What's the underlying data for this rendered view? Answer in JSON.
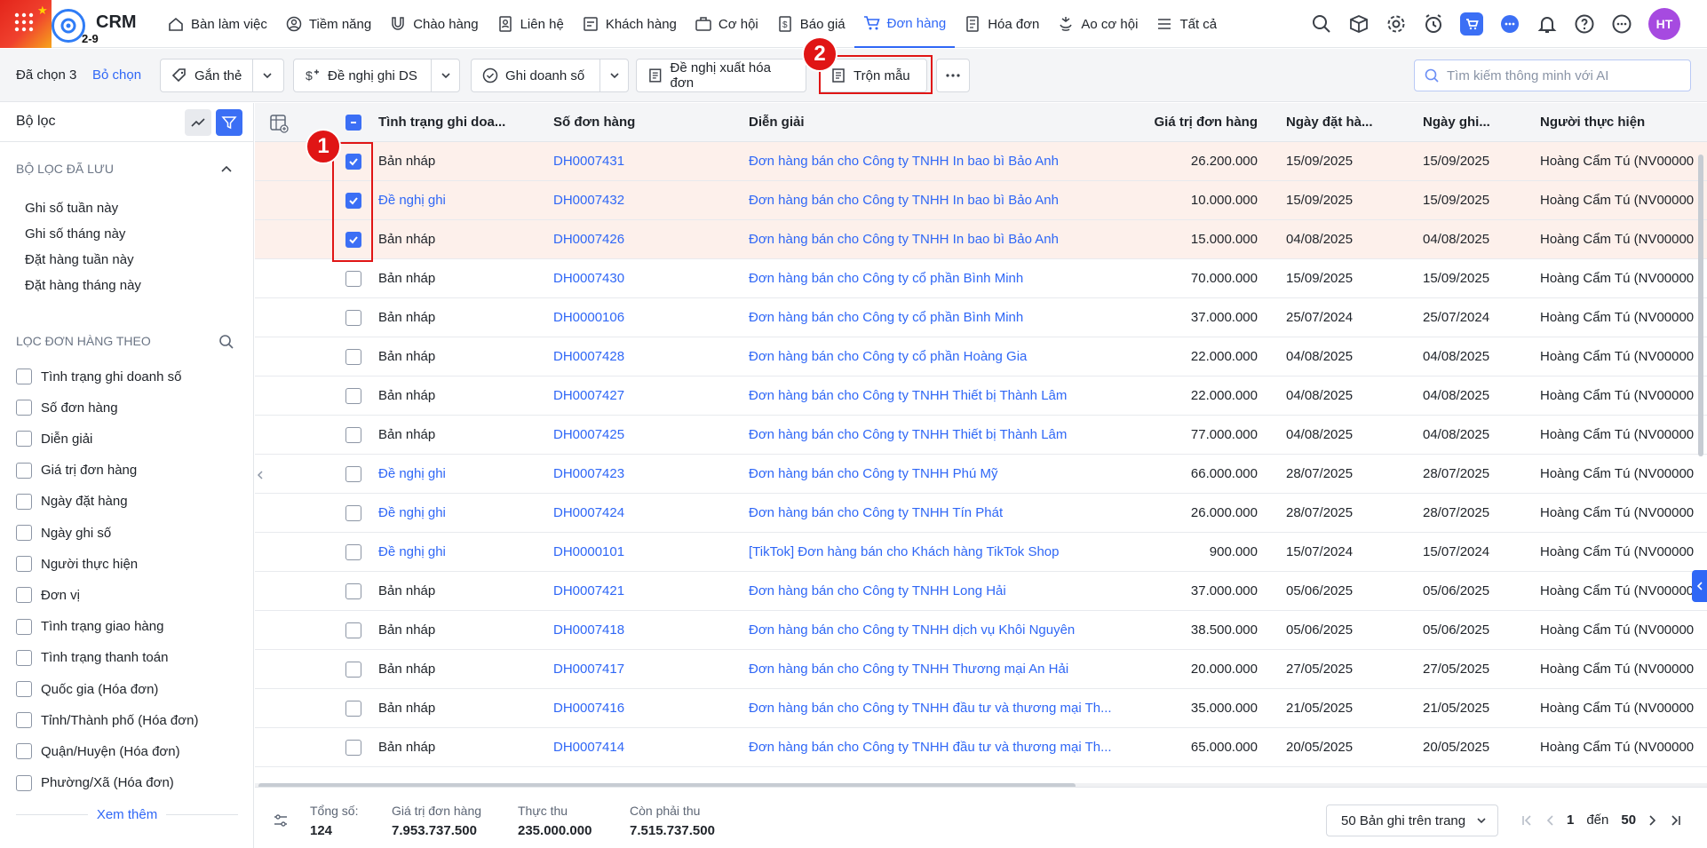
{
  "app": {
    "name": "CRM",
    "sub": "2-9"
  },
  "nav": [
    {
      "label": "Bàn làm việc",
      "icon": "home-icon",
      "active": false
    },
    {
      "label": "Tiềm năng",
      "icon": "prospect-icon",
      "active": false
    },
    {
      "label": "Chào hàng",
      "icon": "magnet-icon",
      "active": false
    },
    {
      "label": "Liên hệ",
      "icon": "contact-icon",
      "active": false
    },
    {
      "label": "Khách hàng",
      "icon": "customer-icon",
      "active": false
    },
    {
      "label": "Cơ hội",
      "icon": "briefcase-icon",
      "active": false
    },
    {
      "label": "Báo giá",
      "icon": "quote-icon",
      "active": false
    },
    {
      "label": "Đơn hàng",
      "icon": "cart-icon",
      "active": true
    },
    {
      "label": "Hóa đơn",
      "icon": "invoice-icon",
      "active": false
    },
    {
      "label": "Ao cơ hội",
      "icon": "pond-icon",
      "active": false
    },
    {
      "label": "Tất cả",
      "icon": "menu-icon",
      "active": false
    }
  ],
  "user": {
    "initials": "HT"
  },
  "toolbar": {
    "selected": "Đã chọn 3",
    "deselect": "Bỏ chọn",
    "tag": "Gắn thẻ",
    "propose_sales": "Đề nghị ghi DS",
    "record_sales": "Ghi doanh số",
    "propose_invoice": "Đề nghị xuất hóa đơn",
    "merge_template": "Trộn mẫu",
    "search_placeholder": "Tìm kiếm thông minh với AI"
  },
  "annotations": {
    "one": "1",
    "two": "2"
  },
  "sidebar": {
    "title": "Bộ lọc",
    "saved_section": "BỘ LỌC ĐÃ LƯU",
    "saved": [
      "Ghi số tuần này",
      "Ghi số tháng này",
      "Đặt hàng tuần này",
      "Đặt hàng tháng này"
    ],
    "filter_section": "LỌC ĐƠN HÀNG THEO",
    "filters": [
      "Tình trạng ghi doanh số",
      "Số đơn hàng",
      "Diễn giải",
      "Giá trị đơn hàng",
      "Ngày đặt hàng",
      "Ngày ghi số",
      "Người thực hiện",
      "Đơn vị",
      "Tình trạng giao hàng",
      "Tình trạng thanh toán",
      "Quốc gia (Hóa đơn)",
      "Tỉnh/Thành phố (Hóa đơn)",
      "Quận/Huyện (Hóa đơn)",
      "Phường/Xã (Hóa đơn)"
    ],
    "more": "Xem thêm"
  },
  "table": {
    "columns": [
      "Tình trạng ghi doa...",
      "Số đơn hàng",
      "Diễn giải",
      "Giá trị đơn hàng",
      "Ngày đặt hà...",
      "Ngày ghi...",
      "Người thực hiện"
    ],
    "rows": [
      {
        "selected": true,
        "status": "Bản nháp",
        "status_link": false,
        "no": "DH0007431",
        "desc": "Đơn hàng bán cho Công ty TNHH In bao bì Bảo Anh",
        "value": "26.200.000",
        "order_date": "15/09/2025",
        "record_date": "15/09/2025",
        "owner": "Hoàng Cẩm Tú (NV00000"
      },
      {
        "selected": true,
        "status": "Đề nghị ghi",
        "status_link": true,
        "no": "DH0007432",
        "desc": "Đơn hàng bán cho Công ty TNHH In bao bì Bảo Anh",
        "value": "10.000.000",
        "order_date": "15/09/2025",
        "record_date": "15/09/2025",
        "owner": "Hoàng Cẩm Tú (NV00000"
      },
      {
        "selected": true,
        "status": "Bản nháp",
        "status_link": false,
        "no": "DH0007426",
        "desc": "Đơn hàng bán cho Công ty TNHH In bao bì Bảo Anh",
        "value": "15.000.000",
        "order_date": "04/08/2025",
        "record_date": "04/08/2025",
        "owner": "Hoàng Cẩm Tú (NV00000"
      },
      {
        "selected": false,
        "status": "Bản nháp",
        "status_link": false,
        "no": "DH0007430",
        "desc": "Đơn hàng bán cho Công ty cổ phần Bình Minh",
        "value": "70.000.000",
        "order_date": "15/09/2025",
        "record_date": "15/09/2025",
        "owner": "Hoàng Cẩm Tú (NV00000"
      },
      {
        "selected": false,
        "status": "Bản nháp",
        "status_link": false,
        "no": "DH0000106",
        "desc": "Đơn hàng bán cho Công ty cổ phần Bình Minh",
        "value": "37.000.000",
        "order_date": "25/07/2024",
        "record_date": "25/07/2024",
        "owner": "Hoàng Cẩm Tú (NV00000"
      },
      {
        "selected": false,
        "status": "Bản nháp",
        "status_link": false,
        "no": "DH0007428",
        "desc": "Đơn hàng bán cho Công ty cổ phần Hoàng Gia",
        "value": "22.000.000",
        "order_date": "04/08/2025",
        "record_date": "04/08/2025",
        "owner": "Hoàng Cẩm Tú (NV00000"
      },
      {
        "selected": false,
        "status": "Bản nháp",
        "status_link": false,
        "no": "DH0007427",
        "desc": "Đơn hàng bán cho Công ty TNHH Thiết bị Thành Lâm",
        "value": "22.000.000",
        "order_date": "04/08/2025",
        "record_date": "04/08/2025",
        "owner": "Hoàng Cẩm Tú (NV00000"
      },
      {
        "selected": false,
        "status": "Bản nháp",
        "status_link": false,
        "no": "DH0007425",
        "desc": "Đơn hàng bán cho Công ty TNHH Thiết bị Thành Lâm",
        "value": "77.000.000",
        "order_date": "04/08/2025",
        "record_date": "04/08/2025",
        "owner": "Hoàng Cẩm Tú (NV00000"
      },
      {
        "selected": false,
        "status": "Đề nghị ghi",
        "status_link": true,
        "no": "DH0007423",
        "desc": "Đơn hàng bán cho Công ty TNHH Phú Mỹ",
        "value": "66.000.000",
        "order_date": "28/07/2025",
        "record_date": "28/07/2025",
        "owner": "Hoàng Cẩm Tú (NV00000"
      },
      {
        "selected": false,
        "status": "Đề nghị ghi",
        "status_link": true,
        "no": "DH0007424",
        "desc": "Đơn hàng bán cho Công ty TNHH Tín Phát",
        "value": "26.000.000",
        "order_date": "28/07/2025",
        "record_date": "28/07/2025",
        "owner": "Hoàng Cẩm Tú (NV00000"
      },
      {
        "selected": false,
        "status": "Đề nghị ghi",
        "status_link": true,
        "no": "DH0000101",
        "desc": "[TikTok] Đơn hàng bán cho Khách hàng TikTok Shop",
        "value": "900.000",
        "order_date": "15/07/2024",
        "record_date": "15/07/2024",
        "owner": "Hoàng Cẩm Tú (NV00000"
      },
      {
        "selected": false,
        "status": "Bản nháp",
        "status_link": false,
        "no": "DH0007421",
        "desc": "Đơn hàng bán cho Công ty TNHH Long Hải",
        "value": "37.000.000",
        "order_date": "05/06/2025",
        "record_date": "05/06/2025",
        "owner": "Hoàng Cẩm Tú (NV00000"
      },
      {
        "selected": false,
        "status": "Bản nháp",
        "status_link": false,
        "no": "DH0007418",
        "desc": "Đơn hàng bán cho Công ty TNHH dịch vụ Khôi Nguyên",
        "value": "38.500.000",
        "order_date": "05/06/2025",
        "record_date": "05/06/2025",
        "owner": "Hoàng Cẩm Tú (NV00000"
      },
      {
        "selected": false,
        "status": "Bản nháp",
        "status_link": false,
        "no": "DH0007417",
        "desc": "Đơn hàng bán cho Công ty TNHH Thương mại An Hải",
        "value": "20.000.000",
        "order_date": "27/05/2025",
        "record_date": "27/05/2025",
        "owner": "Hoàng Cẩm Tú (NV00000"
      },
      {
        "selected": false,
        "status": "Bản nháp",
        "status_link": false,
        "no": "DH0007416",
        "desc": "Đơn hàng bán cho Công ty TNHH đầu tư và thương mại Th...",
        "value": "35.000.000",
        "order_date": "21/05/2025",
        "record_date": "21/05/2025",
        "owner": "Hoàng Cẩm Tú (NV00000"
      },
      {
        "selected": false,
        "status": "Bản nháp",
        "status_link": false,
        "no": "DH0007414",
        "desc": "Đơn hàng bán cho Công ty TNHH đầu tư và thương mại Th...",
        "value": "65.000.000",
        "order_date": "20/05/2025",
        "record_date": "20/05/2025",
        "owner": "Hoàng Cẩm Tú (NV00000"
      }
    ]
  },
  "footer": {
    "total_label": "Tổng số:",
    "total": "124",
    "value_label": "Giá trị đơn hàng",
    "value": "7.953.737.500",
    "received_label": "Thực thu",
    "received": "235.000.000",
    "remaining_label": "Còn phải thu",
    "remaining": "7.515.737.500",
    "page_size": "50 Bản ghi trên trang",
    "page_from": "1",
    "page_to_label": "đến",
    "page_to": "50"
  },
  "colors": {
    "accent": "#2f67f6",
    "selected_row": "#fdf0eb",
    "annotation": "#e01515",
    "brand_flag": "#e3251b"
  }
}
